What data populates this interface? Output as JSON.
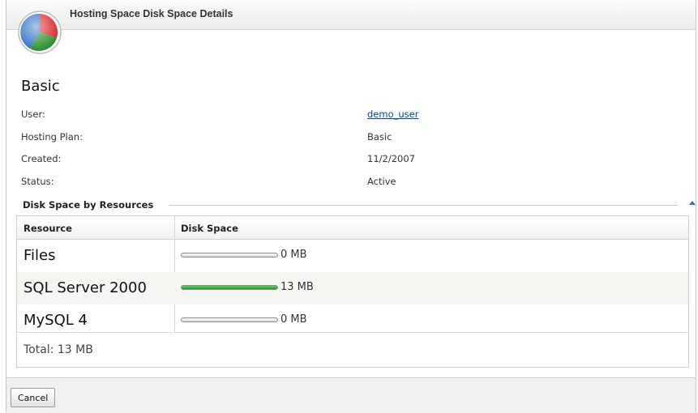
{
  "window": {
    "title": "Hosting Space Disk Space Details"
  },
  "space": {
    "name": "Basic",
    "fields": [
      {
        "label": "User:",
        "value": "demo_user",
        "link": true
      },
      {
        "label": "Hosting Plan:",
        "value": "Basic",
        "link": false
      },
      {
        "label": "Created:",
        "value": "11/2/2007",
        "link": false
      },
      {
        "label": "Status:",
        "value": "Active",
        "link": false
      }
    ]
  },
  "disk_group": {
    "title": "Disk Space by Resources"
  },
  "grid": {
    "headers": [
      "Resource",
      "Disk Space"
    ],
    "rows": [
      {
        "resource": "Files",
        "disk_space": "0 MB",
        "usage_fraction": 0
      },
      {
        "resource": "SQL Server 2000",
        "disk_space": "13 MB",
        "usage_fraction": 1
      },
      {
        "resource": "MySQL 4",
        "disk_space": "0 MB",
        "usage_fraction": 0
      }
    ],
    "total": "Total: 13 MB"
  },
  "footer": {
    "cancel_label": "Cancel"
  },
  "colors": {
    "usage_bar": "#2fae2f",
    "link": "#0645ad"
  },
  "icons": {
    "logo": "pie-chart-logo-icon",
    "collapse": "collapse-up-icon"
  }
}
